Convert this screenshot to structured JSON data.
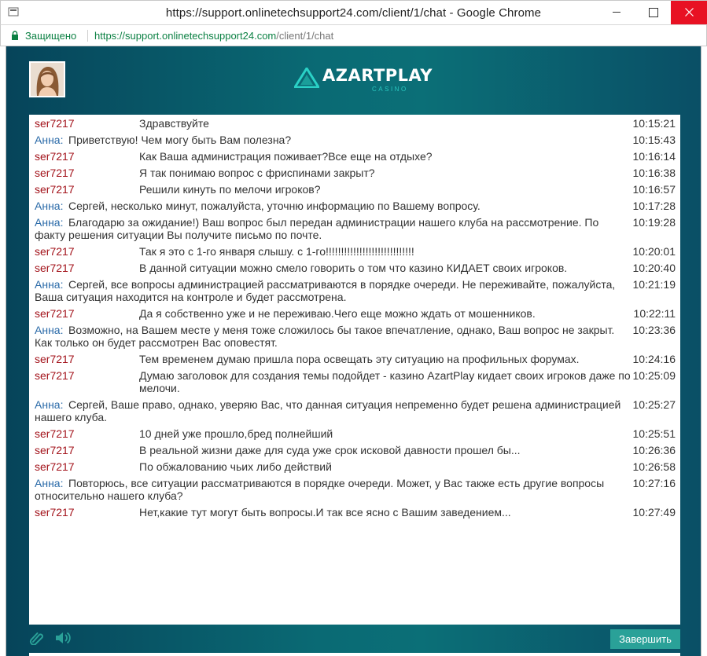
{
  "window": {
    "title": "https://support.onlinetechsupport24.com/client/1/chat - Google Chrome"
  },
  "address": {
    "secure_label": "Защищено",
    "url_host": "https://support.onlinetechsupport24.com",
    "url_path": "/client/1/chat"
  },
  "header": {
    "logo_text": "AZARTPLAY",
    "logo_subtext": "CASINO"
  },
  "messages": [
    {
      "role": "user",
      "sender": "ser7217",
      "text": "Здравствуйте",
      "time": "10:15:21"
    },
    {
      "role": "agent",
      "sender": "Анна:",
      "text": "Приветствую! Чем могу быть Вам полезна?",
      "time": "10:15:43"
    },
    {
      "role": "user",
      "sender": "ser7217",
      "text": "Как Ваша администрация поживает?Все еще на отдыхе?",
      "time": "10:16:14"
    },
    {
      "role": "user",
      "sender": "ser7217",
      "text": "Я так понимаю вопрос с фриспинами закрыт?",
      "time": "10:16:38"
    },
    {
      "role": "user",
      "sender": "ser7217",
      "text": "Решили кинуть по мелочи игроков?",
      "time": "10:16:57"
    },
    {
      "role": "agent",
      "sender": "Анна:",
      "text": "Сергей, несколько минут, пожалуйста, уточню информацию по Вашему вопросу.",
      "time": "10:17:28"
    },
    {
      "role": "agent",
      "sender": "Анна:",
      "text": "Благодарю за ожидание!) Ваш вопрос был передан администрации нашего клуба на рассмотрение. По факту решения ситуации Вы получите письмо по почте.",
      "time": "10:19:28"
    },
    {
      "role": "user",
      "sender": "ser7217",
      "text": "Так я это с 1-го января слышу. с 1-го!!!!!!!!!!!!!!!!!!!!!!!!!!!!!",
      "time": "10:20:01"
    },
    {
      "role": "user",
      "sender": "ser7217",
      "text": "В данной ситуации можно смело говорить о том что казино КИДАЕТ своих игроков.",
      "time": "10:20:40"
    },
    {
      "role": "agent",
      "sender": "Анна:",
      "text": "Сергей, все вопросы администрацией рассматриваются в порядке очереди. Не переживайте, пожалуйста, Ваша ситуация находится на контроле и будет рассмотрена.",
      "time": "10:21:19"
    },
    {
      "role": "user",
      "sender": "ser7217",
      "text": "Да я собственно уже и не переживаю.Чего еще можно ждать от мошенников.",
      "time": "10:22:11"
    },
    {
      "role": "agent",
      "sender": "Анна:",
      "text": "Возможно, на Вашем месте у меня тоже сложилось бы такое впечатление, однако, Ваш вопрос не закрыт. Как только он будет рассмотрен Вас оповестят.",
      "time": "10:23:36"
    },
    {
      "role": "user",
      "sender": "ser7217",
      "text": "Тем временем думаю пришла пора освещать эту ситуацию на профильных форумах.",
      "time": "10:24:16"
    },
    {
      "role": "user",
      "sender": "ser7217",
      "text": "Думаю заголовок для создания темы подойдет - казино AzartPlay кидает своих игроков даже по мелочи.",
      "time": "10:25:09"
    },
    {
      "role": "agent",
      "sender": "Анна:",
      "text": "Сергей, Ваше право, однако, уверяю Вас, что данная ситуация непременно будет решена администрацией нашего клуба.",
      "time": "10:25:27"
    },
    {
      "role": "user",
      "sender": "ser7217",
      "text": "10 дней уже прошло,бред полнейший",
      "time": "10:25:51"
    },
    {
      "role": "user",
      "sender": "ser7217",
      "text": "В реальной жизни даже для суда уже срок исковой давности прошел бы...",
      "time": "10:26:36"
    },
    {
      "role": "user",
      "sender": "ser7217",
      "text": "По обжалованию чьих либо действий",
      "time": "10:26:58"
    },
    {
      "role": "agent",
      "sender": "Анна:",
      "text": "Повторюсь, все ситуации рассматриваются в порядке очереди. Может, у Вас также есть другие вопросы относительно нашего клуба?",
      "time": "10:27:16"
    },
    {
      "role": "user",
      "sender": "ser7217",
      "text": "Нет,какие тут могут быть вопросы.И так все ясно с Вашим заведением...",
      "time": "10:27:49"
    }
  ],
  "footer": {
    "finish_label": "Завершить"
  },
  "icons": {
    "attach": "paperclip-icon",
    "sound": "speaker-icon",
    "secure": "lock-icon"
  },
  "colors": {
    "accent": "#2aa198",
    "user_name": "#a3131b",
    "agent_name": "#2a6aa8",
    "secure_green": "#0b8043"
  }
}
